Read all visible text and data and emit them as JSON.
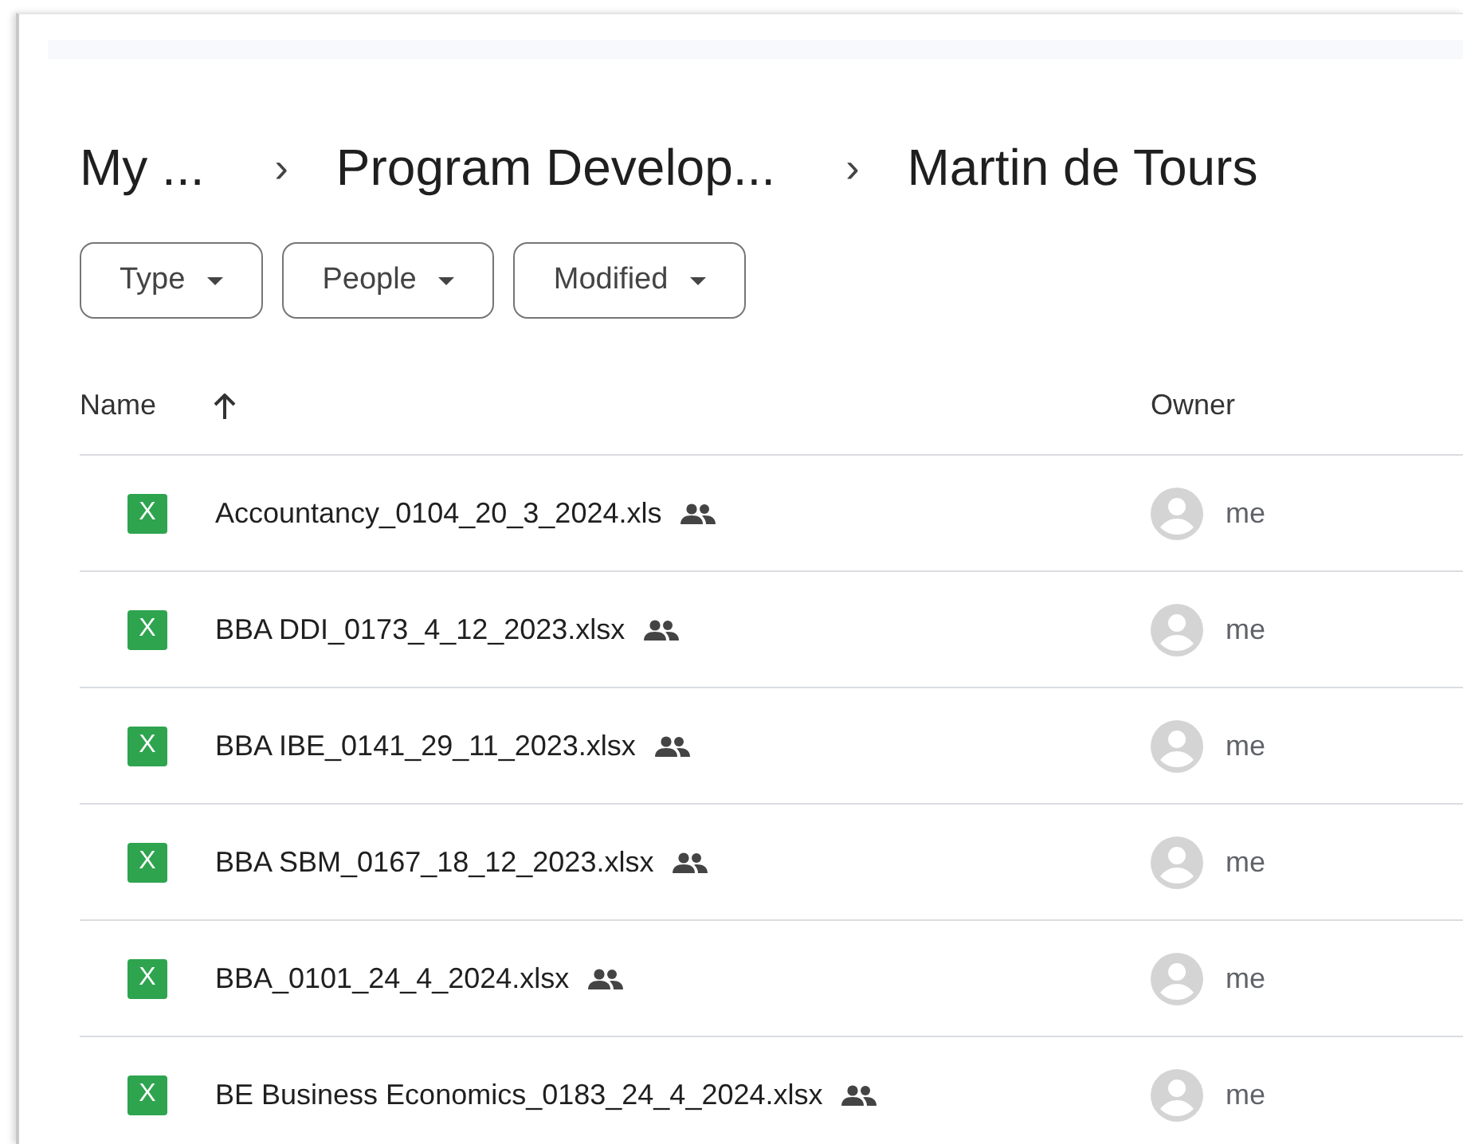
{
  "breadcrumb": {
    "separator": "›",
    "items": [
      "My ...",
      "Program Develop...",
      "Martin de Tours"
    ]
  },
  "filters": [
    {
      "label": "Type"
    },
    {
      "label": "People"
    },
    {
      "label": "Modified"
    }
  ],
  "table": {
    "columns": [
      {
        "label": "Name",
        "sort_ascending": true
      },
      {
        "label": "Owner"
      }
    ],
    "rows": [
      {
        "icon_letter": "X",
        "name": "Accountancy_0104_20_3_2024.xls",
        "shared": true,
        "owner": "me"
      },
      {
        "icon_letter": "X",
        "name": "BBA DDI_0173_4_12_2023.xlsx",
        "shared": true,
        "owner": "me"
      },
      {
        "icon_letter": "X",
        "name": "BBA IBE_0141_29_11_2023.xlsx",
        "shared": true,
        "owner": "me"
      },
      {
        "icon_letter": "X",
        "name": "BBA SBM_0167_18_12_2023.xlsx",
        "shared": true,
        "owner": "me"
      },
      {
        "icon_letter": "X",
        "name": "BBA_0101_24_4_2024.xlsx",
        "shared": true,
        "owner": "me"
      },
      {
        "icon_letter": "X",
        "name": "BE Business Economics_0183_24_4_2024.xlsx",
        "shared": true,
        "owner": "me"
      }
    ]
  }
}
